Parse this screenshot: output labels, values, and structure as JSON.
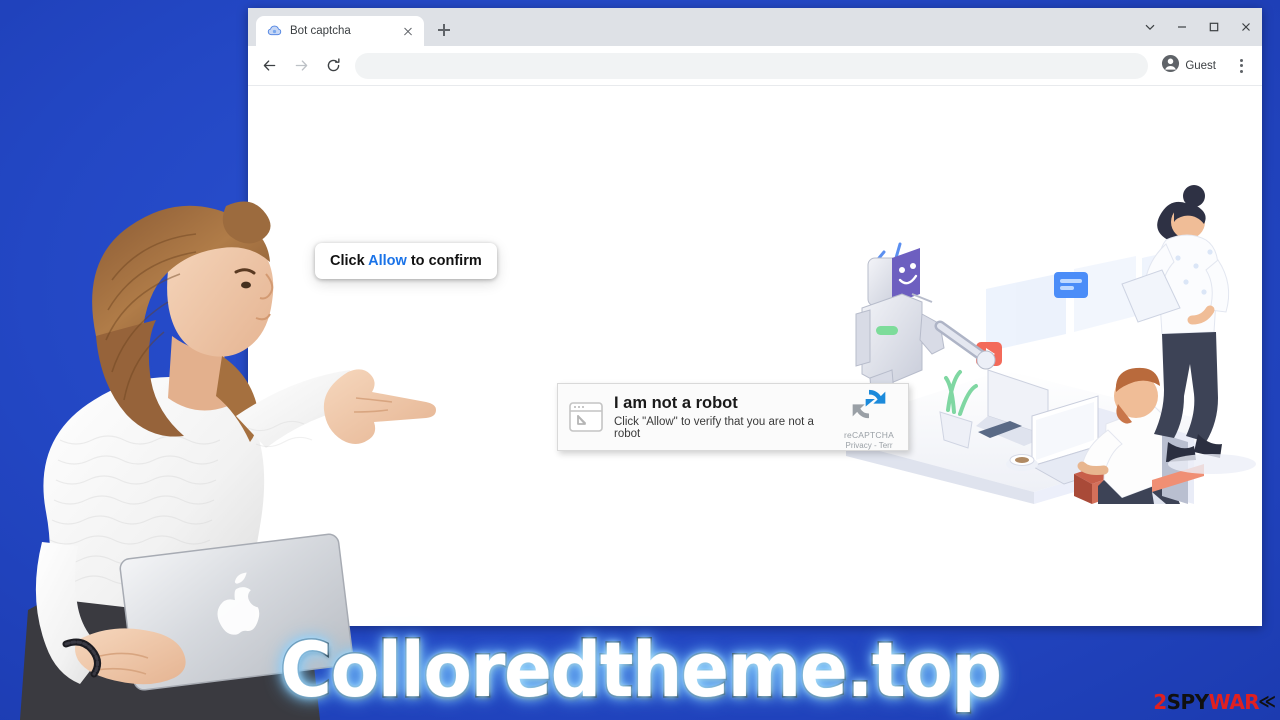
{
  "page": {
    "background_color": "#2347c4",
    "wordmark": "Colloredtheme.top",
    "watermark": {
      "part1": "2",
      "part2": "SPY",
      "part3": "WAR",
      "part4": "E"
    }
  },
  "browser": {
    "tabs": [
      {
        "title": "Bot captcha",
        "favicon": "blue-cloud-icon",
        "close_label": "Close tab"
      }
    ],
    "new_tab_label": "New Tab",
    "window_controls": [
      {
        "name": "tab-search",
        "icon": "chevron-down-icon"
      },
      {
        "name": "minimize",
        "icon": "minimize-icon"
      },
      {
        "name": "maximize",
        "icon": "maximize-icon"
      },
      {
        "name": "close",
        "icon": "close-icon"
      }
    ],
    "toolbar": {
      "back": "Back",
      "forward": "Forward",
      "reload": "Reload",
      "address_value": "",
      "address_placeholder": "",
      "profile_label": "Guest",
      "menu_label": "Customize and control Google Chrome"
    }
  },
  "callout": {
    "prefix": "Click ",
    "accent": "Allow",
    "suffix": " to confirm",
    "accent_color": "#1a73e8"
  },
  "captcha": {
    "icon": "browser-window-cursor-icon",
    "heading": "I am not a robot",
    "subtext": "Click \"Allow\" to verify that you are not a robot",
    "brand": "reCAPTCHA",
    "brand_links": "Privacy - Terr",
    "brand_icon": "recaptcha-logo-icon"
  },
  "illustration": {
    "name": "isometric-office-robot-scene",
    "elements": [
      "humanoid-robot",
      "man-at-desk-with-laptop",
      "woman-standing-with-tablet",
      "desktop-computer",
      "coffee-cup",
      "smartphone",
      "potted-plant",
      "briefcase",
      "floating-ui-cards"
    ]
  },
  "foreground": {
    "name": "woman-pointing-with-macbook",
    "description": "Woman in white knit sweater pointing right, holding a silver laptop"
  }
}
